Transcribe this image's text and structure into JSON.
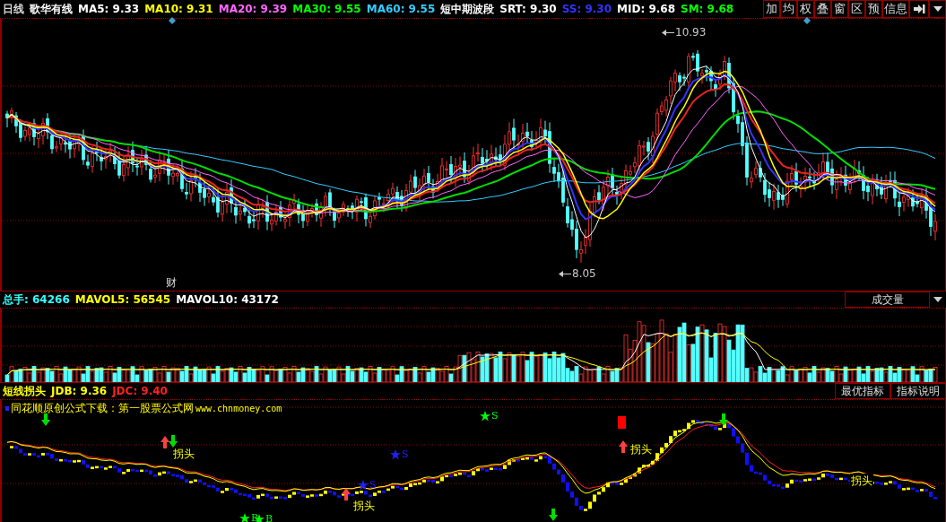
{
  "header": {
    "items": [
      {
        "text": "日线",
        "color": "#d8d8d8"
      },
      {
        "text": "歌华有线",
        "color": "#ffffff"
      },
      {
        "text": "MA5: 9.33",
        "color": "#ffffff"
      },
      {
        "text": "MA10: 9.31",
        "color": "#ffff00"
      },
      {
        "text": "MA20: 9.39",
        "color": "#ff66ff"
      },
      {
        "text": "MA30: 9.55",
        "color": "#00ff00"
      },
      {
        "text": "MA60: 9.55",
        "color": "#33ccff"
      },
      {
        "text": "短中期波段",
        "color": "#ffffff"
      },
      {
        "text": "SRT: 9.30",
        "color": "#ffffff"
      },
      {
        "text": "SS: 9.30",
        "color": "#3333ff"
      },
      {
        "text": "MID: 9.68",
        "color": "#ffffff"
      },
      {
        "text": "SM: 9.68",
        "color": "#00ff00"
      }
    ]
  },
  "toolbar": {
    "buttons": [
      "加",
      "均",
      "权",
      "叠",
      "窗",
      "区",
      "预",
      "信息"
    ]
  },
  "main_chart": {
    "price_labels": [
      {
        "kind": "high",
        "text": "10.93"
      },
      {
        "kind": "low",
        "text": "8.05"
      }
    ],
    "event_marks": [
      "财"
    ]
  },
  "volume_panel": {
    "legend": [
      {
        "text": "总手: 64266",
        "color": "#33ffff"
      },
      {
        "text": "MAVOL5: 56545",
        "color": "#ffff00"
      },
      {
        "text": "MAVOL10: 43172",
        "color": "#ffffff"
      }
    ],
    "button": "成交量"
  },
  "indicator_panel": {
    "legend": [
      {
        "text": "短线拐头",
        "color": "#ffff00"
      },
      {
        "text": "JDB: 9.36",
        "color": "#ffff00"
      },
      {
        "text": "JDC: 9.40",
        "color": "#ff2020"
      }
    ],
    "buttons": [
      "最优指标",
      "指标说明"
    ],
    "notice": "同花顺原创公式下载：第一股票公式网",
    "notice_url": "www.chnmoney.com",
    "arrows": [
      {
        "kind": "down"
      },
      {
        "kind": "up"
      },
      {
        "kind": "down"
      },
      {
        "kind": "up"
      },
      {
        "kind": "down"
      },
      {
        "kind": "up"
      },
      {
        "kind": "down"
      }
    ],
    "stars": [
      {
        "text": "B",
        "color": "#00ff00"
      },
      {
        "text": "B",
        "color": "#00ff00"
      },
      {
        "text": "S",
        "color": "#2020ff"
      },
      {
        "text": "S",
        "color": "#2020ff"
      },
      {
        "text": "S",
        "color": "#00ff00"
      }
    ],
    "turn_labels": [
      "拐头",
      "拐头",
      "拐头",
      "拐头"
    ]
  }
}
